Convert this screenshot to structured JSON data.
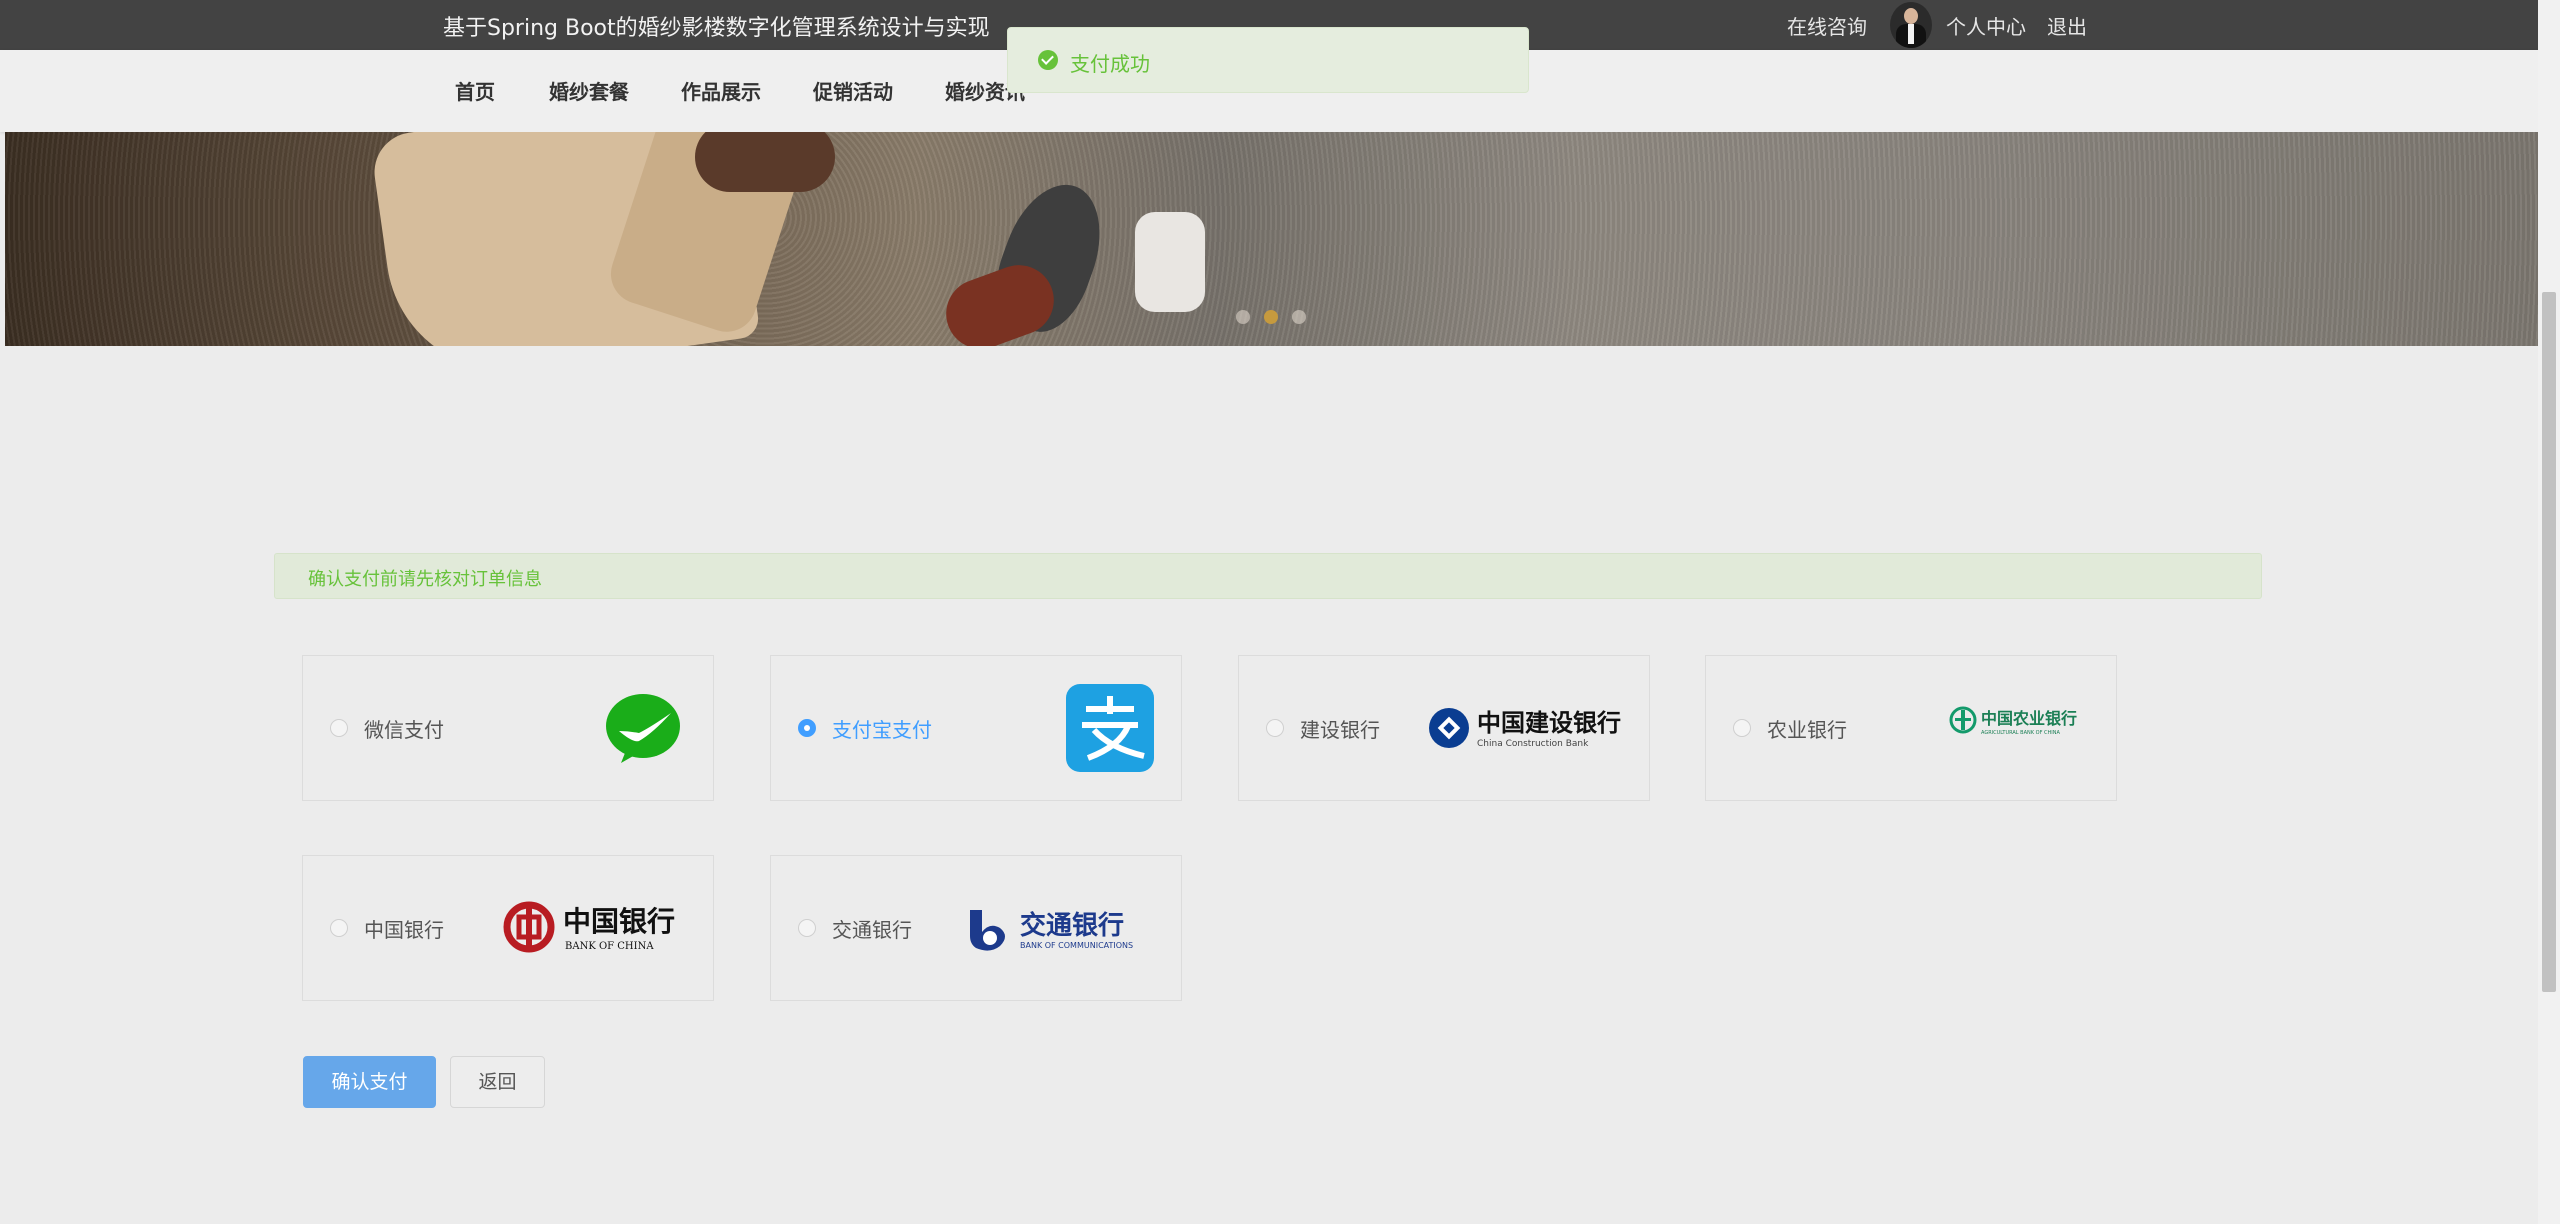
{
  "header": {
    "site_title": "基于Spring Boot的婚纱影楼数字化管理系统设计与实现",
    "consult": "在线咨询",
    "user_center": "个人中心",
    "logout": "退出"
  },
  "nav": {
    "items": [
      "首页",
      "婚纱套餐",
      "作品展示",
      "促销活动",
      "婚纱资讯"
    ]
  },
  "toast": {
    "message": "支付成功",
    "color": "#67c23a"
  },
  "carousel": {
    "slide_count": 3,
    "active_index": 1
  },
  "notice": {
    "text": "确认支付前请先核对订单信息"
  },
  "payment": {
    "selected": "支付宝支付",
    "accent": "#409eff",
    "options": [
      {
        "label": "微信支付",
        "logo": "wechat-pay-logo"
      },
      {
        "label": "支付宝支付",
        "logo": "alipay-logo"
      },
      {
        "label": "建设银行",
        "logo": "ccb-logo",
        "logo_text": "中国建设银行",
        "logo_sub": "China Construction Bank"
      },
      {
        "label": "农业银行",
        "logo": "abc-logo",
        "logo_text": "中国农业银行",
        "logo_sub": "AGRICULTURAL BANK OF CHINA"
      },
      {
        "label": "中国银行",
        "logo": "boc-logo",
        "logo_text": "中国银行",
        "logo_sub": "BANK OF CHINA"
      },
      {
        "label": "交通银行",
        "logo": "bocom-logo",
        "logo_text": "交通银行",
        "logo_sub": "BANK OF COMMUNICATIONS"
      }
    ]
  },
  "actions": {
    "confirm": "确认支付",
    "back": "返回"
  }
}
